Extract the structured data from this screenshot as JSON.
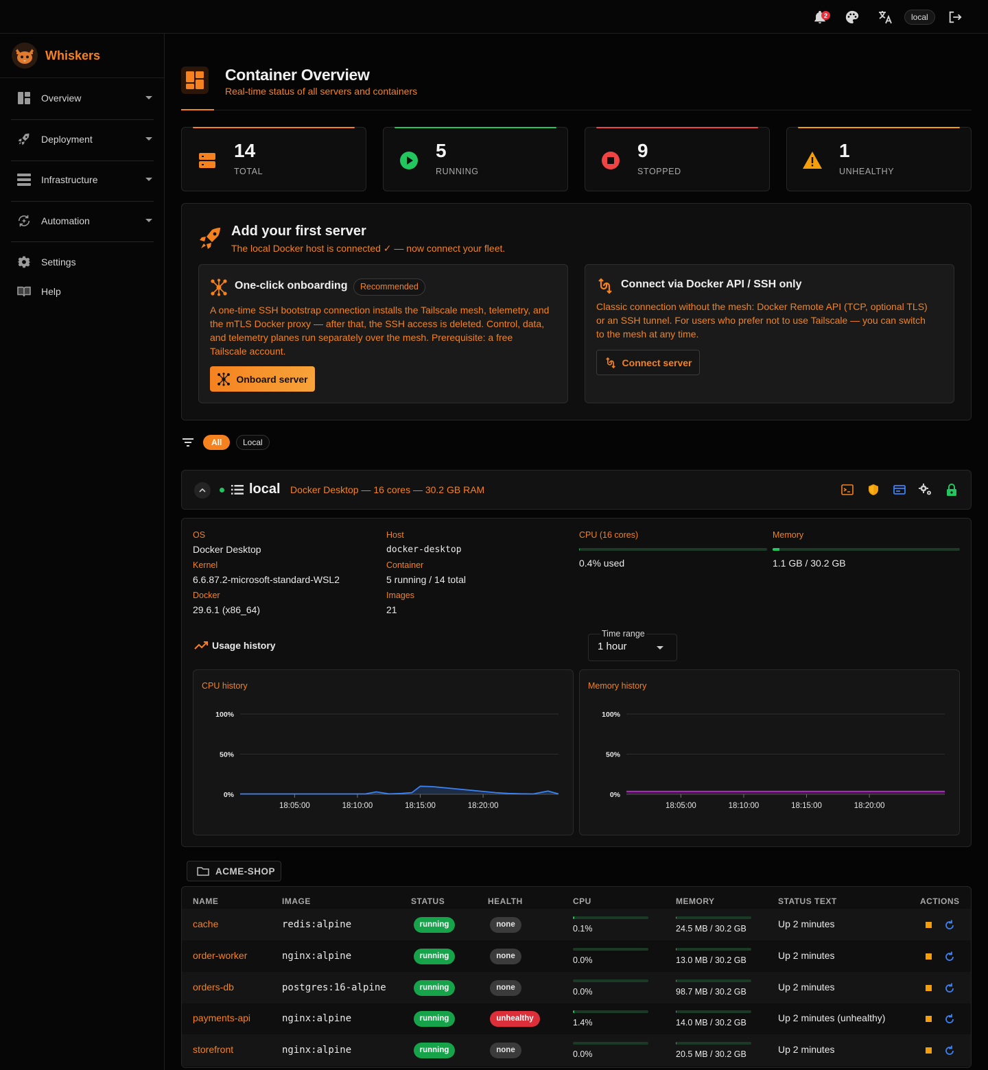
{
  "topbar": {
    "notifications_count": "2",
    "env_label": "local"
  },
  "sidebar": {
    "brand": "Whiskers",
    "items": [
      {
        "label": "Overview"
      },
      {
        "label": "Deployment"
      },
      {
        "label": "Infrastructure"
      },
      {
        "label": "Automation"
      },
      {
        "label": "Settings"
      },
      {
        "label": "Help"
      }
    ]
  },
  "page": {
    "title": "Container Overview",
    "subtitle": "Real-time status of all servers and containers"
  },
  "stats": [
    {
      "value": "14",
      "label": "TOTAL",
      "color": "#f5821f"
    },
    {
      "value": "5",
      "label": "RUNNING",
      "color": "#22c55e"
    },
    {
      "value": "9",
      "label": "STOPPED",
      "color": "#ef4444"
    },
    {
      "value": "1",
      "label": "UNHEALTHY",
      "color": "#f59e0b"
    }
  ],
  "onboarding": {
    "title": "Add your first server",
    "subtitle": "The local Docker host is connected ✓ — now connect your fleet.",
    "oneclick": {
      "title": "One-click onboarding",
      "badge": "Recommended",
      "text": "A one-time SSH bootstrap connection installs the Tailscale mesh, telemetry, and the mTLS Docker proxy — after that, the SSH access is deleted. Control, data, and telemetry planes run separately over the mesh. Prerequisite: a free Tailscale account.",
      "button": "Onboard server"
    },
    "direct": {
      "title": "Connect via Docker API / SSH only",
      "text": "Classic connection without the mesh: Docker Remote API (TCP, optional TLS) or an SSH tunnel. For users who prefer not to use Tailscale — you can switch to the mesh at any time.",
      "button": "Connect server"
    }
  },
  "filters": {
    "all": "All",
    "local": "Local"
  },
  "server": {
    "name": "local",
    "description": "Docker Desktop — 16 cores — 30.2 GB RAM",
    "status_color": "#22c55e",
    "os_label": "OS",
    "os": "Docker Desktop",
    "kernel_label": "Kernel",
    "kernel": "6.6.87.2-microsoft-standard-WSL2",
    "docker_label": "Docker",
    "docker": "29.6.1 (x86_64)",
    "host_label": "Host",
    "host": "docker-desktop",
    "container_label": "Container",
    "container": "5 running / 14 total",
    "images_label": "Images",
    "images": "21",
    "cpu_label": "CPU (16 cores)",
    "cpu_value": "0.4% used",
    "cpu_fraction": 0.004,
    "memory_label": "Memory",
    "memory_value": "1.1 GB / 30.2 GB",
    "memory_fraction": 0.036,
    "usage_history_label": "Usage history",
    "time_range_label": "Time range",
    "time_range_value": "1 hour"
  },
  "chart_data": [
    {
      "type": "line",
      "title": "CPU history",
      "color": "#3b82f6",
      "yticks": [
        "100%",
        "50%",
        "0%"
      ],
      "xticks": [
        "18:05:00",
        "18:10:00",
        "18:15:00",
        "18:20:00"
      ],
      "ylim": [
        0,
        100
      ],
      "x": [
        "18:00:40",
        "18:02:00",
        "18:04:00",
        "18:06:00",
        "18:08:00",
        "18:10:00",
        "18:10:40",
        "18:11:30",
        "18:12:30",
        "18:13:30",
        "18:14:20",
        "18:15:00",
        "18:16:00",
        "18:17:00",
        "18:18:00",
        "18:19:00",
        "18:20:00",
        "18:21:00",
        "18:22:00",
        "18:23:00",
        "18:24:00",
        "18:25:10",
        "18:26:00"
      ],
      "series": [
        {
          "values": [
            0.4,
            0.4,
            0.4,
            0.4,
            0.4,
            0.4,
            0.5,
            3,
            0.5,
            1,
            2,
            10,
            9.5,
            8,
            6.5,
            5,
            3.5,
            2,
            1,
            0.6,
            0.4,
            4,
            0.4
          ]
        }
      ]
    },
    {
      "type": "line",
      "title": "Memory history",
      "color": "#c026d3",
      "yticks": [
        "100%",
        "50%",
        "0%"
      ],
      "xticks": [
        "18:05:00",
        "18:10:00",
        "18:15:00",
        "18:20:00"
      ],
      "ylim": [
        0,
        100
      ],
      "x": [
        "18:00:40",
        "18:26:00"
      ],
      "series": [
        {
          "values": [
            3.6,
            3.6
          ]
        }
      ]
    }
  ],
  "group": {
    "label": "ACME-SHOP"
  },
  "table": {
    "headers": {
      "name": "NAME",
      "image": "IMAGE",
      "status": "STATUS",
      "health": "HEALTH",
      "cpu": "CPU",
      "memory": "MEMORY",
      "status_text": "STATUS TEXT",
      "actions": "ACTIONS"
    },
    "rows": [
      {
        "name": "cache",
        "image": "redis:alpine",
        "status": "running",
        "health": "none",
        "cpu": "0.1%",
        "cpu_fraction": 0.001,
        "memory": "24.5 MB / 30.2 GB",
        "memory_fraction": 0.0008,
        "status_text": "Up 2 minutes"
      },
      {
        "name": "order-worker",
        "image": "nginx:alpine",
        "status": "running",
        "health": "none",
        "cpu": "0.0%",
        "cpu_fraction": 0.0,
        "memory": "13.0 MB / 30.2 GB",
        "memory_fraction": 0.0004,
        "status_text": "Up 2 minutes"
      },
      {
        "name": "orders-db",
        "image": "postgres:16-alpine",
        "status": "running",
        "health": "none",
        "cpu": "0.0%",
        "cpu_fraction": 0.0,
        "memory": "98.7 MB / 30.2 GB",
        "memory_fraction": 0.0032,
        "status_text": "Up 2 minutes"
      },
      {
        "name": "payments-api",
        "image": "nginx:alpine",
        "status": "running",
        "health": "unhealthy",
        "cpu": "1.4%",
        "cpu_fraction": 0.014,
        "memory": "14.0 MB / 30.2 GB",
        "memory_fraction": 0.0005,
        "status_text": "Up 2 minutes (unhealthy)"
      },
      {
        "name": "storefront",
        "image": "nginx:alpine",
        "status": "running",
        "health": "none",
        "cpu": "0.0%",
        "cpu_fraction": 0.0,
        "memory": "20.5 MB / 30.2 GB",
        "memory_fraction": 0.0007,
        "status_text": "Up 2 minutes"
      }
    ]
  }
}
